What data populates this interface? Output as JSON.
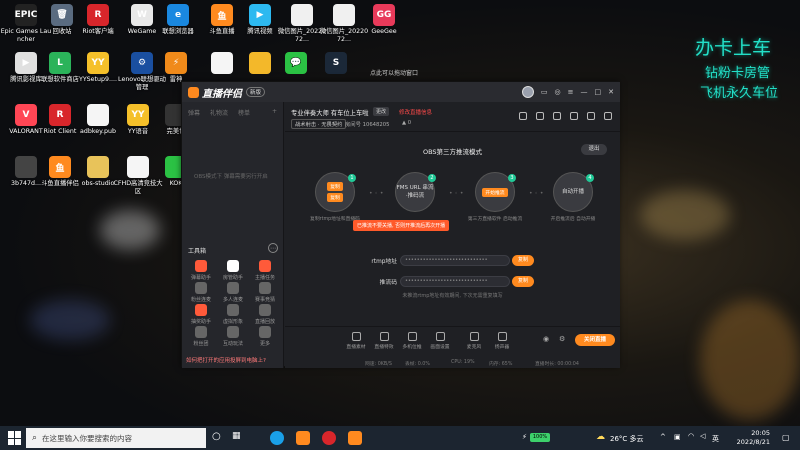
{
  "desktop": {
    "icons": [
      {
        "label": "Epic Games Launcher",
        "name": "epic-games-launcher",
        "glyph": "EPIC",
        "color": "#222222"
      },
      {
        "label": "回收站",
        "name": "recycle-bin",
        "glyph": "🗑",
        "color": "#5a6b80"
      },
      {
        "label": "Riot客户端",
        "name": "riot-client-cn",
        "glyph": "R",
        "color": "#d8262b"
      },
      {
        "label": "WeGame",
        "name": "wegame",
        "glyph": "W",
        "color": "#e8e8e8"
      },
      {
        "label": "联想浏览器",
        "name": "lenovo-browser",
        "glyph": "e",
        "color": "#1a88e0"
      },
      {
        "label": "斗鱼直播",
        "name": "douyu-live",
        "glyph": "鱼",
        "color": "#ff8a1f"
      },
      {
        "label": "腾讯视频",
        "name": "tencent-video",
        "glyph": "▶",
        "color": "#2db9f0"
      },
      {
        "label": "微信图片_2022072...",
        "name": "wechat-image-1",
        "glyph": "",
        "color": "#f0f0f0"
      },
      {
        "label": "微信图片_2022072...",
        "name": "wechat-image-2",
        "glyph": "",
        "color": "#f0f0f0"
      },
      {
        "label": "GeeGee",
        "name": "geegee",
        "glyph": "GG",
        "color": "#e83a5a"
      },
      {
        "label": "腾讯影视库",
        "name": "tencent-film-library",
        "glyph": "▶",
        "color": "#e0e0e0"
      },
      {
        "label": "联想软件商店",
        "name": "lenovo-app-store",
        "glyph": "L",
        "color": "#2bb35a"
      },
      {
        "label": "YYSetup9....",
        "name": "yy-setup",
        "glyph": "YY",
        "color": "#f5c02a"
      },
      {
        "label": "Lenovo联想驱动管理",
        "name": "lenovo-driver-manager",
        "glyph": "⚙",
        "color": "#1a4fa0"
      },
      {
        "label": "雷神",
        "name": "leishen",
        "glyph": "⚡",
        "color": "#f08a1a"
      },
      {
        "label": "",
        "name": "blank-file",
        "glyph": "",
        "color": "#f5f5f5"
      },
      {
        "label": "",
        "name": "cartoon-app",
        "glyph": "",
        "color": "#f3b82a"
      },
      {
        "label": "",
        "name": "wechat",
        "glyph": "💬",
        "color": "#2bc244"
      },
      {
        "label": "",
        "name": "steam",
        "glyph": "S",
        "color": "#1b2838"
      },
      {
        "label": "VALORANT",
        "name": "valorant",
        "glyph": "V",
        "color": "#ff4655"
      },
      {
        "label": "Riot Client",
        "name": "riot-client",
        "glyph": "R",
        "color": "#d8262b"
      },
      {
        "label": "adbkey.pub",
        "name": "adbkey-file",
        "glyph": "",
        "color": "#f5f5f5"
      },
      {
        "label": "YY语音",
        "name": "yy-voice",
        "glyph": "YY",
        "color": "#f5c02a"
      },
      {
        "label": "完美世",
        "name": "perfect-world",
        "glyph": "",
        "color": "#333333"
      },
      {
        "label": "3b747d...",
        "name": "image-file",
        "glyph": "",
        "color": "#444444"
      },
      {
        "label": "斗鱼直播伴侣",
        "name": "douyu-companion",
        "glyph": "鱼",
        "color": "#ff8a1f"
      },
      {
        "label": "obs-studio",
        "name": "obs-studio-folder",
        "glyph": "",
        "color": "#e8c35a"
      },
      {
        "label": "CFHD高清竞技大区",
        "name": "cfhd",
        "glyph": "",
        "color": "#f5f5f5"
      },
      {
        "label": "KOK",
        "name": "kok",
        "glyph": "",
        "color": "#2bc244"
      }
    ],
    "floating_text": "点此可以拖动窗口",
    "wallpaper_lines": [
      "办卡上车",
      "钻粉卡房管",
      "飞机永久车位"
    ]
  },
  "app": {
    "logo": "直播伴侣",
    "version": "新版",
    "left_tabs": [
      "弹幕",
      "礼物流",
      "榜单",
      "+"
    ],
    "left_hint": "OBS模式下 弹幕需要另行开启",
    "tools_title": "工具箱",
    "tools": [
      {
        "label": "弹幕助手",
        "color": "#ff5a3a"
      },
      {
        "label": "房管助手",
        "color": "#ffffff"
      },
      {
        "label": "主播任务",
        "color": "#ff5a3a"
      },
      {
        "label": "粉丝连麦",
        "color": "#666666"
      },
      {
        "label": "多人连麦",
        "color": "#666666"
      },
      {
        "label": "赛事竞猜",
        "color": "#666666"
      },
      {
        "label": "抽奖助手",
        "color": "#ff5a3a"
      },
      {
        "label": "虚拟形象",
        "color": "#666666"
      },
      {
        "label": "直播回放",
        "color": "#666666"
      },
      {
        "label": "粉丝团",
        "color": "#666666"
      },
      {
        "label": "互动玩法",
        "color": "#666666"
      },
      {
        "label": "更多",
        "color": "#666666"
      }
    ],
    "notice": "如何把打开的应用投屏到电脑上?",
    "room": {
      "title": "专业伴奏大师 有车位上车啦",
      "tag": "更改",
      "edit": "修改直播信息",
      "category": "战术射击 · 无畏契约",
      "room_id": "房间号 10648205",
      "fans": "0"
    },
    "obs": {
      "title": "OBS第三方推流模式",
      "exit": "退出",
      "steps": [
        {
          "num": "1",
          "pills": [
            "复制",
            "复制"
          ],
          "text": "",
          "caption": "复制rtmp地址和直播码"
        },
        {
          "num": "2",
          "pills": [],
          "text": "FMS URL 串流·推码流",
          "caption": ""
        },
        {
          "num": "3",
          "pills": [
            "开始推流"
          ],
          "text": "",
          "caption": "第三方直播软件 启动推流"
        },
        {
          "num": "4",
          "pills": [],
          "text": "自动开播",
          "caption": "开启推流后 自动开播"
        }
      ],
      "warning": "已推流不要关播, 否则开推流后再次开播",
      "rtmp_label": "rtmp地址",
      "rtmp_value": "••••••••••••••••••••••••••••",
      "key_label": "推流码",
      "key_value": "••••••••••••••••••••••••••••",
      "copy_label": "复制",
      "hint": "未推流rtmp地址有效期间, 下次无需重复填写"
    },
    "bottom_items": [
      "直播素材",
      "直播特效",
      "多机位推",
      "画面设置",
      "麦克风",
      "扬声器"
    ],
    "live_button": "关闭直播",
    "status": [
      "直播时长: 00:00:04",
      "网速: 0KB/S",
      "丢帧: 0.0%",
      "CPU: 19%",
      "内存: 65%"
    ]
  },
  "taskbar": {
    "search_placeholder": "在这里输入你要搜索的内容",
    "battery": "100%",
    "weather": "26°C 多云",
    "lang": "英",
    "time": "20:05",
    "date": "2022/8/21"
  }
}
